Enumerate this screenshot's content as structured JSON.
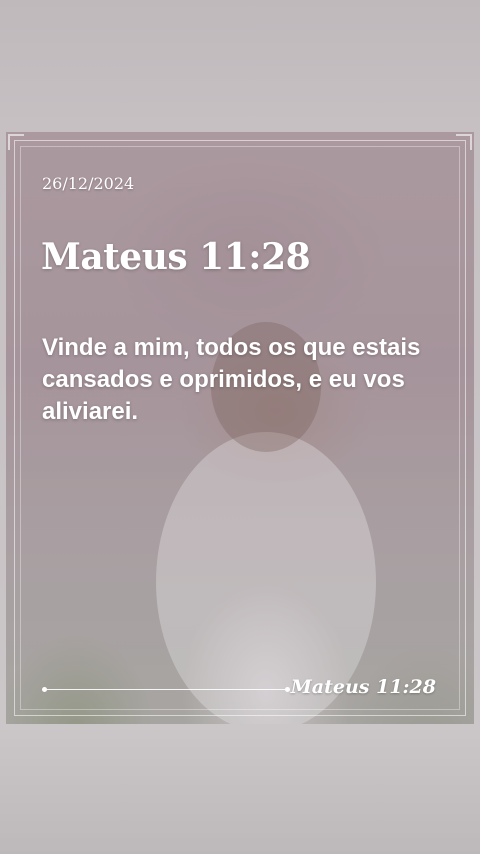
{
  "card": {
    "date": "26/12/2024",
    "title": "Mateus 11:28",
    "verse": "Vinde a mim, todos os que estais cansados e oprimidos, e eu vos aliviarei.",
    "reference": "Mateus 11:28"
  },
  "colors": {
    "background": "#c9c4c6",
    "text": "#ffffff",
    "overlay": "#b9a9b1"
  },
  "icons": {
    "background_image": "man-giving-thumbs-up-with-child-photo"
  }
}
